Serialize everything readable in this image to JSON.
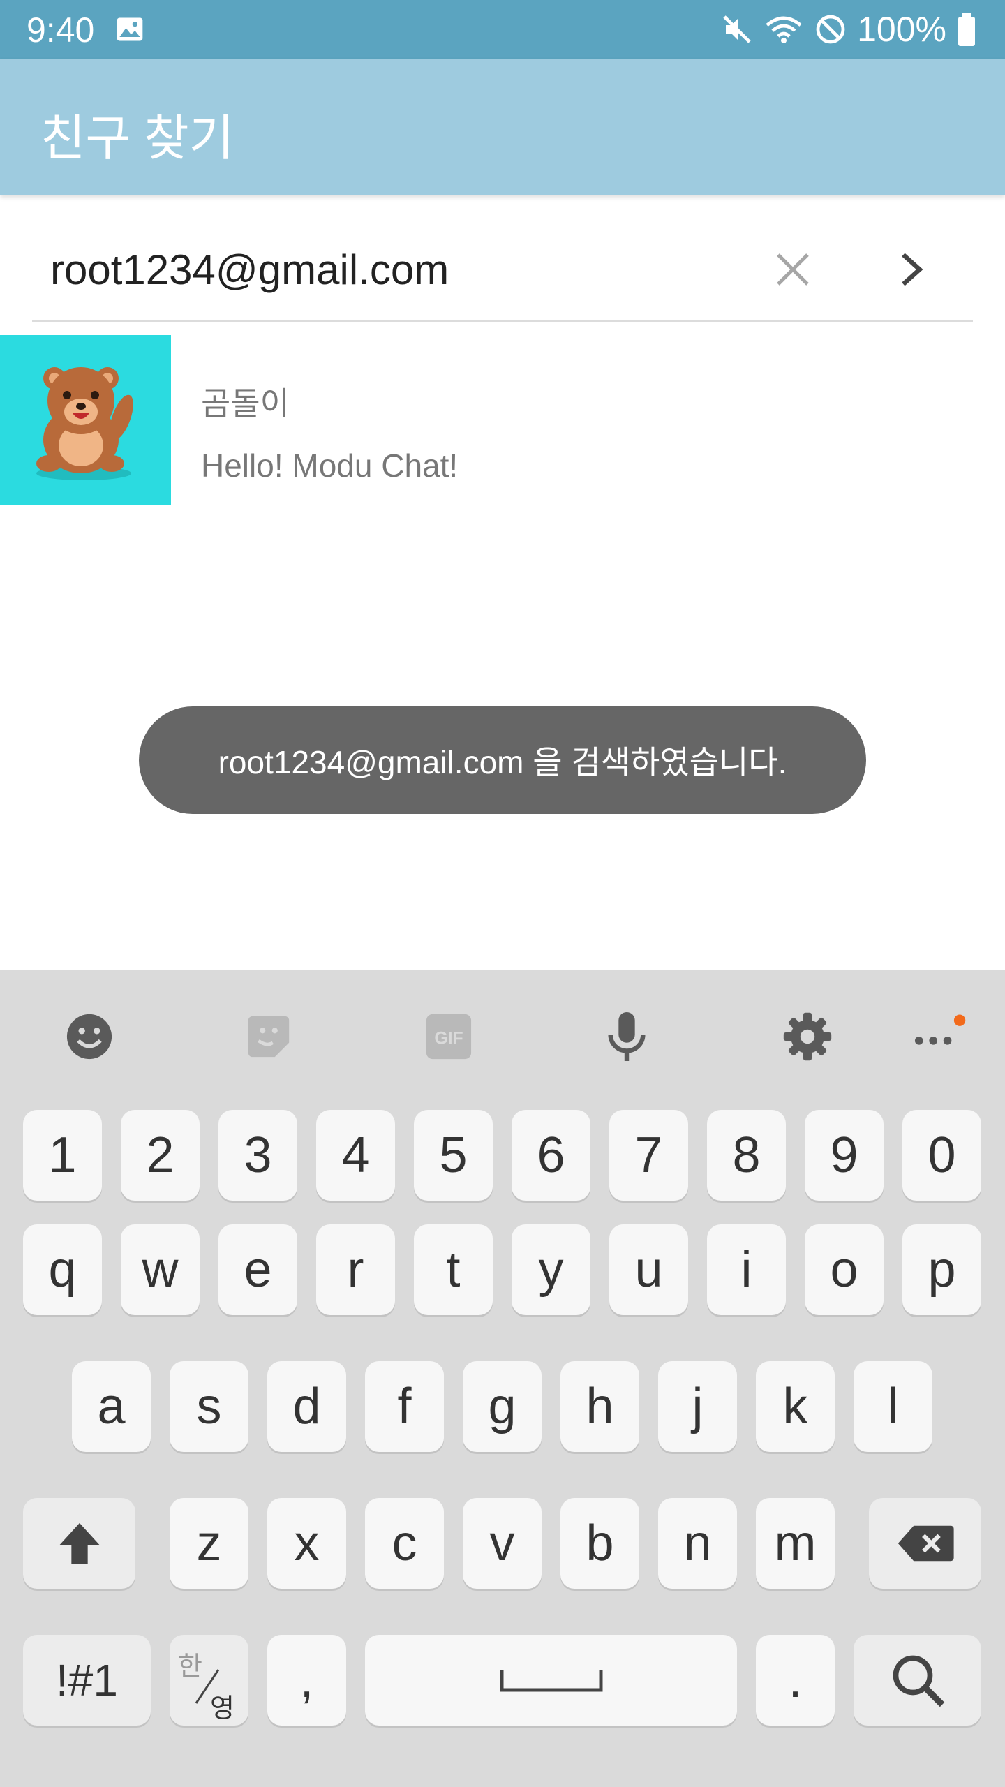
{
  "status_bar": {
    "time": "9:40",
    "battery": "100%"
  },
  "app_bar": {
    "title": "친구 찾기"
  },
  "search": {
    "value": "root1234@gmail.com"
  },
  "result": {
    "name": "곰돌이",
    "status_message": "Hello! Modu Chat!"
  },
  "toast": {
    "message": "root1234@gmail.com 을 검색하였습니다."
  },
  "keyboard": {
    "toolbar": [
      "emoji-icon",
      "sticker-icon",
      "gif-icon",
      "microphone-icon",
      "settings-icon",
      "more-icon"
    ],
    "gif_label": "GIF",
    "row_numbers": [
      "1",
      "2",
      "3",
      "4",
      "5",
      "6",
      "7",
      "8",
      "9",
      "0"
    ],
    "row_top": [
      "q",
      "w",
      "e",
      "r",
      "t",
      "y",
      "u",
      "i",
      "o",
      "p"
    ],
    "row_middle": [
      "a",
      "s",
      "d",
      "f",
      "g",
      "h",
      "j",
      "k",
      "l"
    ],
    "row_bottom": [
      "z",
      "x",
      "c",
      "v",
      "b",
      "n",
      "m"
    ],
    "symbols_label": "!#1",
    "lang_top": "한",
    "lang_bottom": "영",
    "comma": ",",
    "period": "."
  },
  "colors": {
    "status_bar": "#5ba4c0",
    "app_bar": "#9ecbdf",
    "avatar_bg": "#2bdbe0",
    "toast_bg": "#666666",
    "keyboard_bg": "#dadada",
    "notification_dot": "#f26a1b"
  }
}
